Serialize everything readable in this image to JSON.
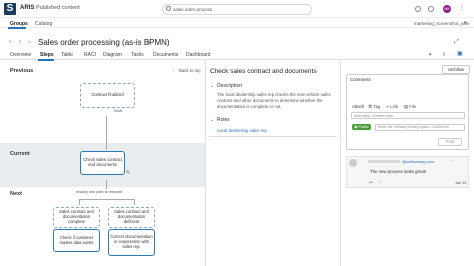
{
  "app": {
    "logo_letter": "S",
    "brand": "ARIS",
    "brand_sub": "Published content",
    "search_value": "sales order process",
    "avatar_initials": "MB"
  },
  "nav": {
    "tabs": [
      "Groups",
      "Catalog"
    ],
    "user_right": "marketing_screenshot_user"
  },
  "page": {
    "title": "Sales order processing (as-is BPMN)",
    "tabs": [
      "Overview",
      "Steps",
      "Table",
      "RACI",
      "Diagram",
      "Tasks",
      "Documents",
      "Dashboard"
    ]
  },
  "left": {
    "previous_label": "Previous",
    "current_label": "Current",
    "next_label": "Next",
    "back_to_top": "Back to top",
    "prev_box": "Contract finalized",
    "prev_start": "Start",
    "current_box": "Check sales contract and documents",
    "exactly_one": "exactly one path is relevant",
    "next_a_top": "Sales contract and documentation complete",
    "next_a_bottom": "Check if customer master data exists",
    "next_b_top": "Sales contract and documentation deficient",
    "next_b_bottom": "Correct documentation in cooperation with sales rep."
  },
  "middle": {
    "heading": "Check sales contract and documents",
    "description_label": "Description",
    "description_text": "The local dealership sales rep checks the new vehicle sales contract and other documents to determine whether the documentation is complete or not.",
    "roles_label": "Roles",
    "role_link": "Local dealership sales rep"
  },
  "right": {
    "unfollow": "Unfollow",
    "comments_label": "Comments",
    "attach_label": "Attach",
    "tag_label": "Tag",
    "link_label": "Link",
    "file_label": "File",
    "reply_placeholder": "Add reply. Confirm with",
    "public_label": "Public",
    "privacy_placeholder": "Enter the relevant privacy option. Confirm wi",
    "post_label": "Post",
    "comment_author": "@softwareag.com",
    "comment_text": "The new process looks great!",
    "comment_date": "Jan 19"
  }
}
